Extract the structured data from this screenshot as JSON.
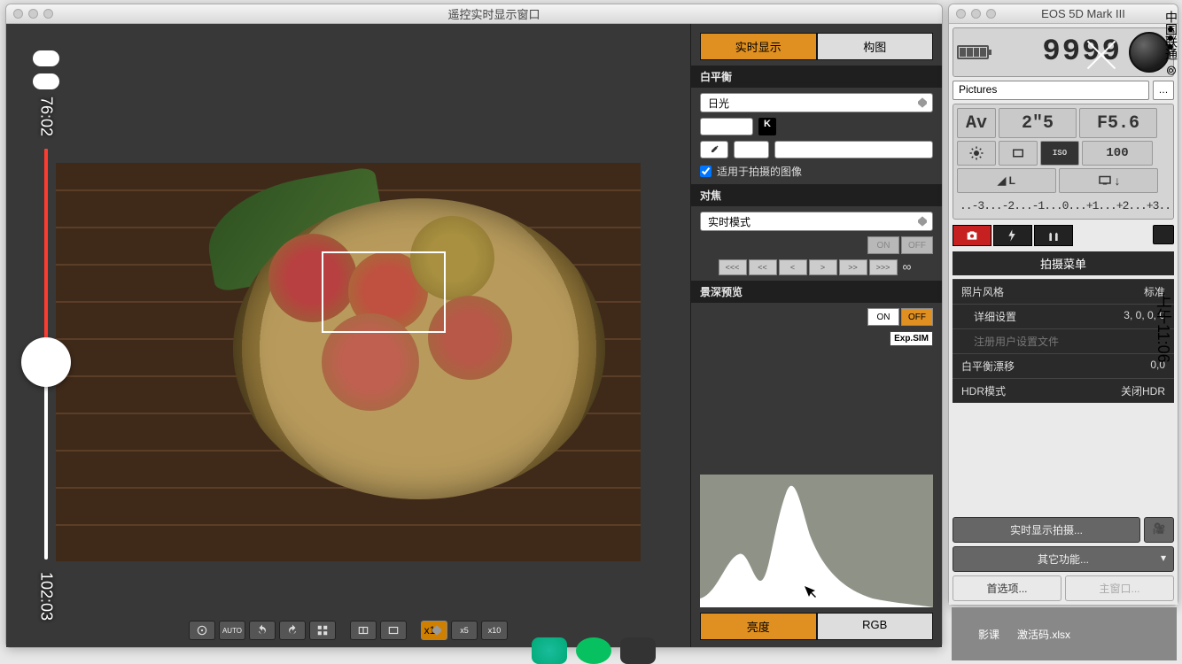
{
  "live_window": {
    "title": "遥控实时显示窗口",
    "slider": {
      "time_top": "76:02",
      "time_bottom": "102:03"
    },
    "toolbar": {
      "auto": "AUTO",
      "zoom1": "x1",
      "zoom5": "x5",
      "zoom10": "x10"
    },
    "tabs": {
      "live": "实时显示",
      "compose": "构图"
    },
    "wb": {
      "header": "白平衡",
      "preset": "日光",
      "kelvin_badge": "K",
      "apply_checkbox": "适用于拍摄的图像"
    },
    "focus": {
      "header": "对焦",
      "mode": "实时模式",
      "on": "ON",
      "off": "OFF",
      "nav": [
        "<<<",
        "<<",
        "<",
        ">",
        ">>",
        ">>>"
      ],
      "inf": "∞"
    },
    "dof": {
      "header": "景深预览",
      "on": "ON",
      "off": "OFF",
      "expsim": "Exp.SIM"
    },
    "hist_tabs": {
      "brightness": "亮度",
      "rgb": "RGB"
    }
  },
  "eos_window": {
    "title": "EOS 5D Mark III",
    "shots": "9999",
    "folder": "Pictures",
    "mode": "Av",
    "shutter": "2\"5",
    "aperture": "F5.6",
    "iso_label": "ISO",
    "iso": "100",
    "meter": "..-3...-2...-1...0...+1...+2...+3..",
    "menu_title": "拍摄菜单",
    "menu": [
      {
        "label": "照片风格",
        "value": "标准",
        "ind": false,
        "disabled": false
      },
      {
        "label": "详细设置",
        "value": "3, 0, 0, 0",
        "ind": true,
        "disabled": false
      },
      {
        "label": "注册用户设置文件",
        "value": "",
        "ind": true,
        "disabled": true
      },
      {
        "label": "白平衡漂移",
        "value": "0,0",
        "ind": false,
        "disabled": false
      },
      {
        "label": "HDR模式",
        "value": "关闭HDR",
        "ind": false,
        "disabled": false
      }
    ],
    "btn_liveview": "实时显示拍摄...",
    "btn_other": "其它功能...",
    "btn_prefs": "首选项...",
    "btn_main": "主窗口..."
  },
  "overlay": {
    "carrier": "中国联通",
    "time": "上午11:06",
    "peek1": "影课",
    "peek2": "激活码.xlsx"
  }
}
